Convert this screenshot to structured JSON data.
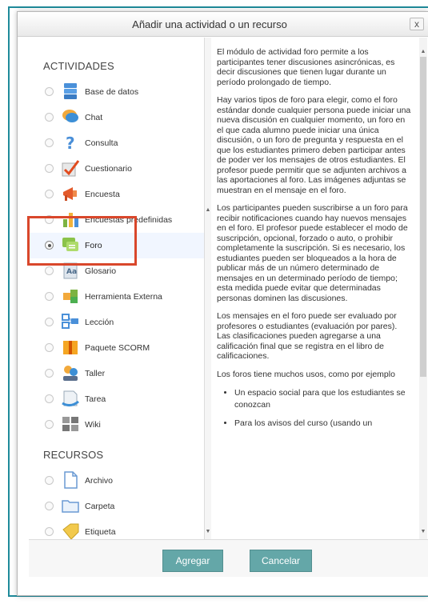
{
  "background": {
    "text": "…"
  },
  "dialog": {
    "title": "Añadir una actividad o un recurso",
    "close_label": "x"
  },
  "activities": {
    "heading": "ACTIVIDADES",
    "items": [
      {
        "label": "Base de datos",
        "icon": "database-icon",
        "selected": false
      },
      {
        "label": "Chat",
        "icon": "chat-icon",
        "selected": false
      },
      {
        "label": "Consulta",
        "icon": "question-icon",
        "selected": false
      },
      {
        "label": "Cuestionario",
        "icon": "checkmark-icon",
        "selected": false
      },
      {
        "label": "Encuesta",
        "icon": "megaphone-icon",
        "selected": false
      },
      {
        "label": "Encuestas predefinidas",
        "icon": "bar-chart-icon",
        "selected": false
      },
      {
        "label": "Foro",
        "icon": "forum-icon",
        "selected": true
      },
      {
        "label": "Glosario",
        "icon": "glossary-icon",
        "selected": false
      },
      {
        "label": "Herramienta Externa",
        "icon": "puzzle-icon",
        "selected": false
      },
      {
        "label": "Lección",
        "icon": "lesson-icon",
        "selected": false
      },
      {
        "label": "Paquete SCORM",
        "icon": "scorm-icon",
        "selected": false
      },
      {
        "label": "Taller",
        "icon": "workshop-icon",
        "selected": false
      },
      {
        "label": "Tarea",
        "icon": "assignment-icon",
        "selected": false
      },
      {
        "label": "Wiki",
        "icon": "wiki-icon",
        "selected": false
      }
    ]
  },
  "resources": {
    "heading": "RECURSOS",
    "items": [
      {
        "label": "Archivo",
        "icon": "file-icon",
        "selected": false
      },
      {
        "label": "Carpeta",
        "icon": "folder-icon",
        "selected": false
      },
      {
        "label": "Etiqueta",
        "icon": "label-icon",
        "selected": false
      }
    ]
  },
  "description": {
    "paragraphs": [
      "El módulo de actividad foro permite a los participantes tener discusiones asincrónicas, es decir discusiones que tienen lugar durante un período prolongado de tiempo.",
      "Hay varios tipos de foro para elegir, como el foro estándar donde cualquier persona puede iniciar una nueva discusión en cualquier momento, un foro en el que cada alumno puede iniciar una única discusión, o un foro de pregunta y respuesta en el que los estudiantes primero deben participar antes de poder ver los mensajes de otros estudiantes. El profesor puede permitir que se adjunten archivos a las aportaciones al foro. Las imágenes adjuntas se muestran en el mensaje en el foro.",
      "Los participantes pueden suscribirse a un foro para recibir notificaciones cuando hay nuevos mensajes en el foro. El profesor puede establecer el modo de suscripción, opcional, forzado o auto, o prohibir completamente la suscripción. Si es necesario, los estudiantes pueden ser bloqueados a la hora de publicar más de un número determinado de mensajes en un determinado período de tiempo; esta medida puede evitar que determinadas personas dominen las discusiones.",
      "Los mensajes en el foro puede ser evaluado por profesores o estudiantes (evaluación por pares). Las clasificaciones pueden agregarse a una calificación final que se registra en el libro de calificaciones.",
      "Los foros tiene muchos usos, como por ejemplo"
    ],
    "list": [
      "Un espacio social para que los estudiantes se conozcan",
      "Para los avisos del curso (usando un"
    ]
  },
  "footer": {
    "add_label": "Agregar",
    "cancel_label": "Cancelar"
  },
  "colors": {
    "frame": "#1f8a9a",
    "button": "#64a7a8",
    "highlight": "#d9472b",
    "selected_row": "#f1f6ff"
  }
}
